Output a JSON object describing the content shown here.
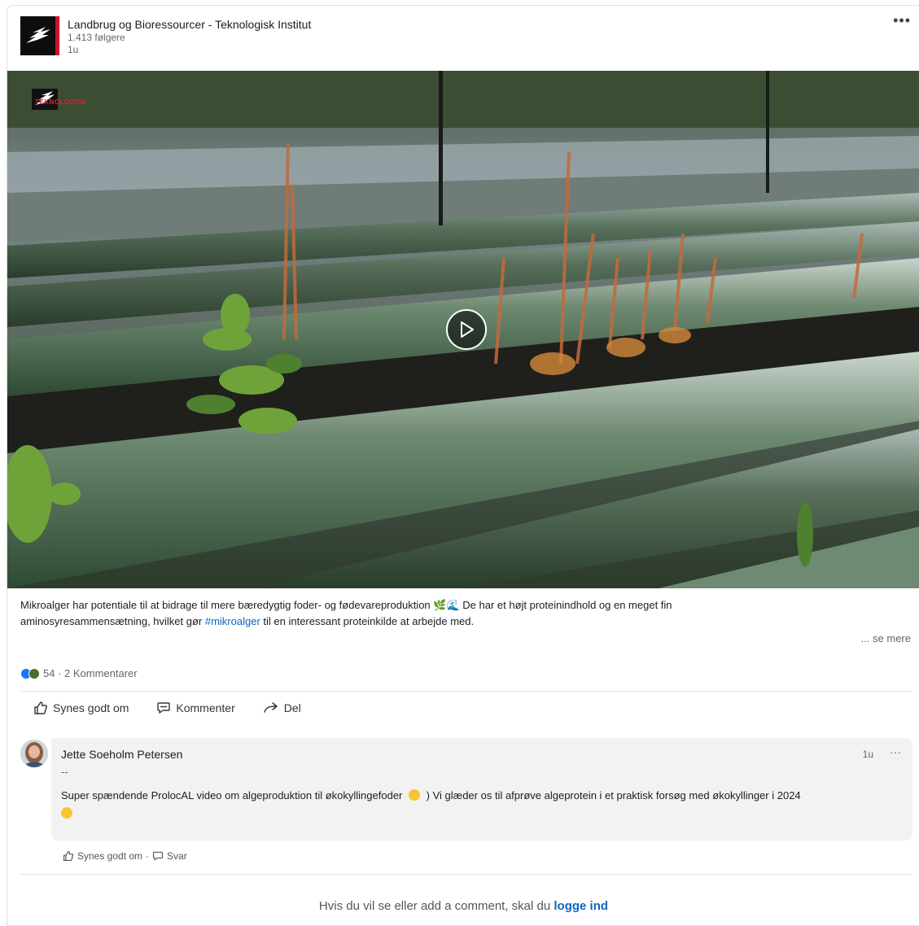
{
  "post": {
    "org_name": "Landbrug og Bioressourcer - Teknologisk Institut",
    "followers": "1.413 følgere",
    "time": "1u",
    "more_label": "•••",
    "video_watermark": "TEKNOLOGISK",
    "caption_part1": "Mikroalger har potentiale til at bidrage til mere bæredygtig foder- og fødevareproduktion 🌿🌊 De har et højt proteinindhold og en meget fin aminosyresammensætning, hvilket gør ",
    "hashtag": "#mikroalger",
    "caption_part2": " til en interessant proteinkilde at arbejde med.",
    "see_more": "... se mere"
  },
  "reactions": {
    "count_text": "54 · 2 Kommentarer",
    "colors": [
      "#1877f2",
      "#44712e"
    ]
  },
  "actions": {
    "like": "Synes godt om",
    "comment": "Kommenter",
    "share": "Del"
  },
  "comment": {
    "author": "Jette Soeholm Petersen",
    "time": "1u",
    "more": "···",
    "dash": "--",
    "text_part1": "Super spændende ProlocAL video om algeproduktion til økokyllingefoder",
    "text_part2": ") Vi glæder os til afprøve algeprotein i et praktisk forsøg med økokyllinger i 2024",
    "like": "Synes godt om",
    "separator": "·",
    "reply": "Svar"
  },
  "login_prompt": {
    "text": "Hvis du vil se eller add a comment, skal du ",
    "link": "logge ind"
  },
  "colors": {
    "accent": "#0a66c2",
    "brand_red": "#d0112b"
  }
}
